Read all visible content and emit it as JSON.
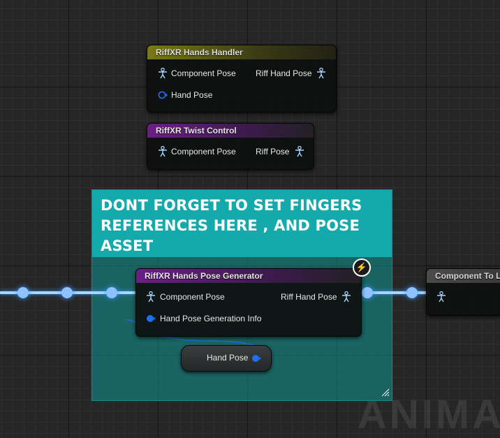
{
  "nodes": {
    "hands_handler": {
      "title": "RiffXR Hands Handler",
      "input_component_pose": "Component Pose",
      "input_hand_pose": "Hand Pose",
      "output_riff_hand_pose": "Riff Hand Pose"
    },
    "twist_control": {
      "title": "RiffXR Twist Control",
      "input_component_pose": "Component Pose",
      "output_riff_pose": "Riff Pose"
    },
    "pose_generator": {
      "title": "RiffXR Hands Pose Generator",
      "input_component_pose": "Component Pose",
      "input_generation_info": "Hand Pose Generation Info",
      "output_riff_hand_pose": "Riff Hand Pose"
    },
    "component_to_local": {
      "title": "Component To L"
    },
    "hand_pose_variable": {
      "label": "Hand Pose"
    }
  },
  "comment": {
    "text": "DONT FORGET TO SET FINGERS REFERENCES HERE , AND POSE ASSET"
  },
  "watermark": "ANIMAT",
  "colors": {
    "header_yellow": "#7a7a14",
    "header_purple": "#6c1f86",
    "comment_teal": "#14a9ab",
    "pose_pin_blue": "#a9d6ff",
    "struct_pin_blue": "#1e6ff0"
  },
  "icons": {
    "pose_pin": "person-pose-icon",
    "struct_pin": "struct-pin-icon",
    "dispatch": "lightning-icon"
  }
}
